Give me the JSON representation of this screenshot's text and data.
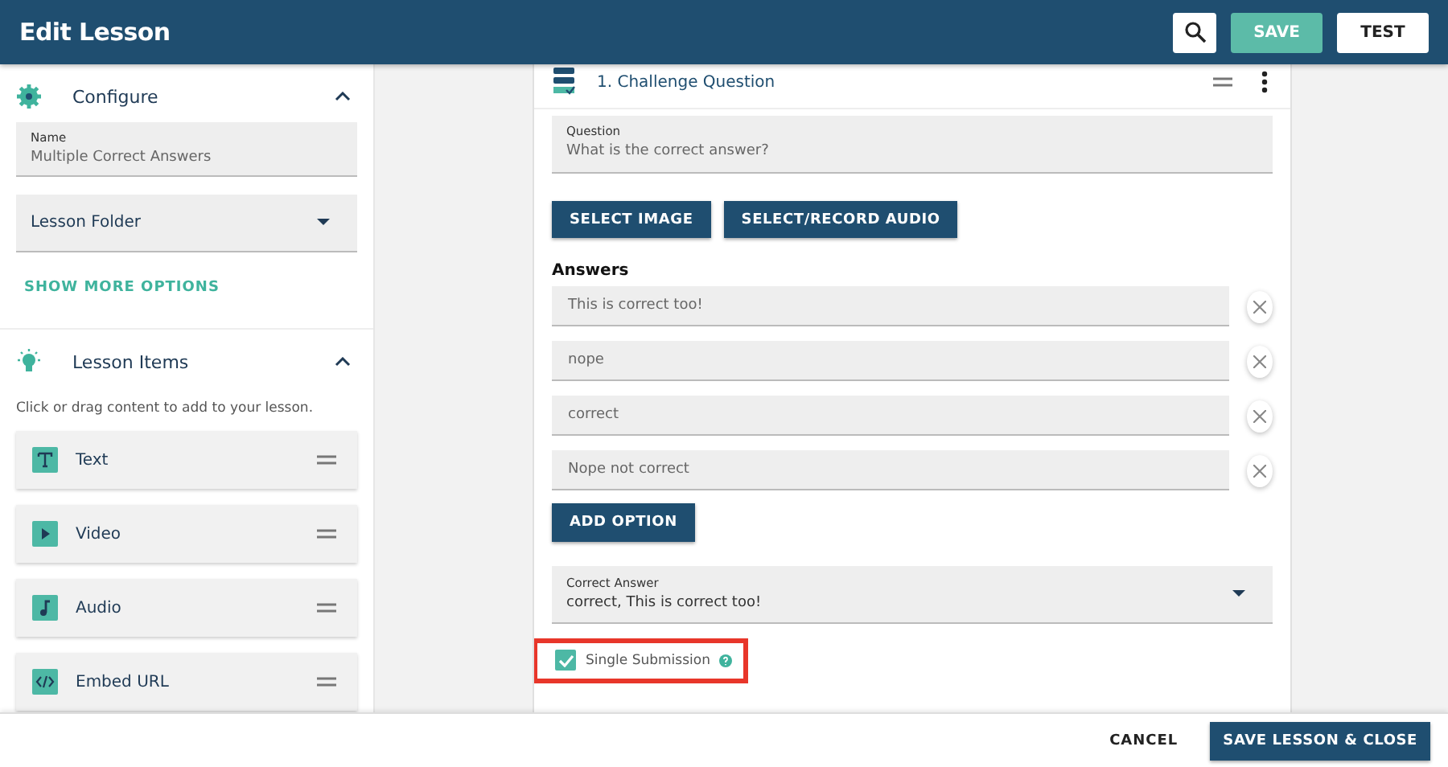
{
  "header": {
    "title": "Edit Lesson",
    "buttons": [
      {
        "kind": "search"
      },
      {
        "kind": "primary",
        "label": "SAVE"
      },
      {
        "kind": "outline",
        "label": "TEST"
      }
    ]
  },
  "sidebar": {
    "configure": {
      "title": "Configure",
      "expanded": true,
      "name_field": {
        "label": "Name",
        "value": "Multiple Correct Answers"
      },
      "folder_select": {
        "placeholder": "Lesson Folder"
      },
      "more_link": "SHOW MORE OPTIONS"
    },
    "lesson_items": {
      "title": "Lesson Items",
      "expanded": true,
      "hint": "Click or drag content to add to your lesson.",
      "items": [
        {
          "kind": "text",
          "label": "Text"
        },
        {
          "kind": "video",
          "label": "Video"
        },
        {
          "kind": "audio",
          "label": "Audio"
        },
        {
          "kind": "embed",
          "label": "Embed URL"
        }
      ]
    }
  },
  "card": {
    "title": "1. Challenge Question",
    "question": {
      "label": "Question",
      "value": "What is the correct answer?"
    },
    "media_buttons": [
      "SELECT IMAGE",
      "SELECT/RECORD AUDIO"
    ],
    "answers_heading": "Answers",
    "answers": [
      {
        "value": "This is correct too!"
      },
      {
        "value": "nope"
      },
      {
        "value": "correct"
      },
      {
        "value": "Nope not correct"
      }
    ],
    "add_option": "ADD OPTION",
    "correct_answer": {
      "label": "Correct Answer",
      "value": "correct, This is correct too!"
    },
    "single_submission": {
      "label": "Single Submission",
      "checked": true,
      "highlighted": true
    }
  },
  "footer": {
    "cancel": "CANCEL",
    "save_close": "SAVE LESSON & CLOSE"
  }
}
